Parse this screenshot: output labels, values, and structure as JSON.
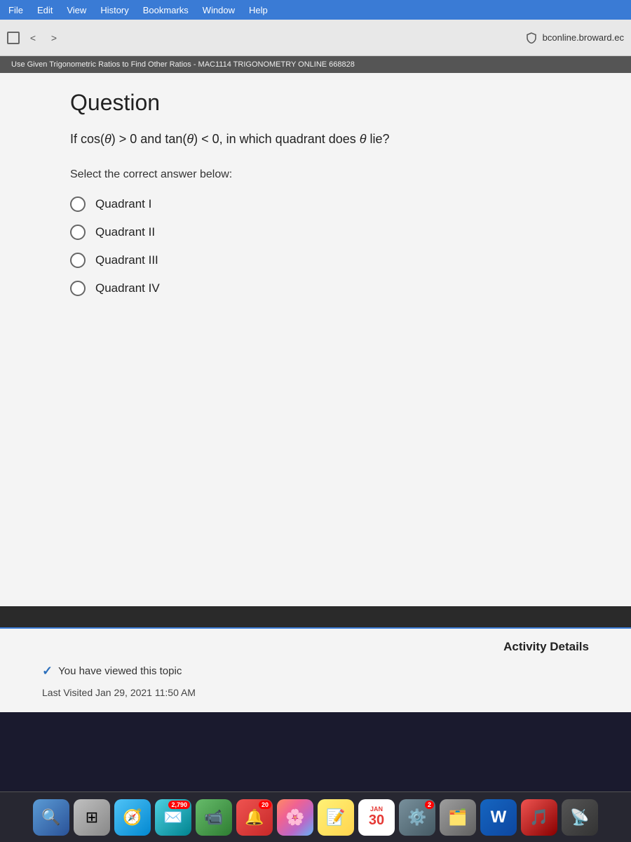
{
  "menubar": {
    "items": [
      "File",
      "Edit",
      "View",
      "History",
      "Bookmarks",
      "Window",
      "Help"
    ]
  },
  "browser": {
    "address": "bconline.broward.ec",
    "back_label": "<",
    "forward_label": ">"
  },
  "page": {
    "title_bar": "Use Given Trigonometric Ratios to Find Other Ratios - MAC1114 TRIGONOMETRY ONLINE 668828",
    "question_heading": "Question",
    "question_text_part1": "If cos(θ) > 0 and tan(θ) < 0, in which quadrant does θ lie?",
    "select_label": "Select the correct answer below:",
    "options": [
      "Quadrant I",
      "Quadrant II",
      "Quadrant III",
      "Quadrant IV"
    ],
    "activity_details_label": "Activity Details",
    "viewed_text": "You have viewed this topic",
    "last_visited": "Last Visited Jan 29, 2021 11:50 AM"
  },
  "dock": {
    "calendar_month": "JAN",
    "calendar_day": "30",
    "badge_mail": "2,790",
    "badge_reminders": "20",
    "badge_other": "2"
  }
}
